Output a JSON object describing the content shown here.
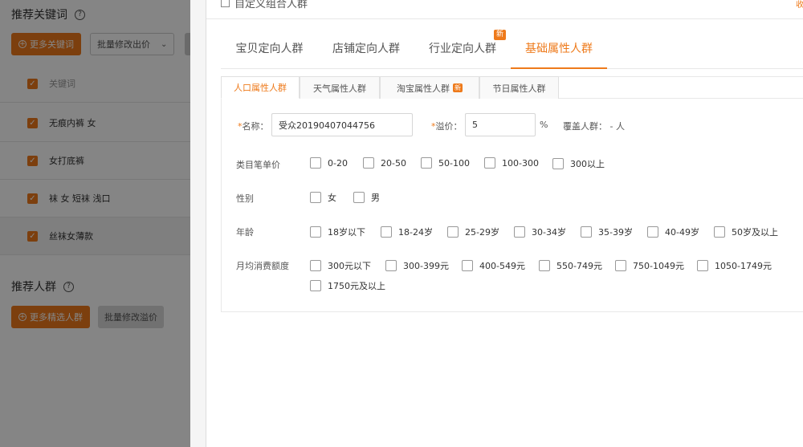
{
  "left_panel": {
    "keywords_title": "推荐关键词",
    "more_keywords_label": "更多关键词",
    "batch_bid_label": "批量修改出价",
    "keyword_header": "关键词",
    "keywords": [
      "无痕内裤 女",
      "女打底裤",
      "袜 女 短袜 浅口",
      "丝袜女薄款"
    ],
    "crowd_title": "推荐人群",
    "more_crowd_label": "更多精选人群",
    "batch_premium_label": "批量修改溢价"
  },
  "modal": {
    "title": "自定义组合人群",
    "collapse_label": "收",
    "main_tabs": [
      {
        "label": "宝贝定向人群"
      },
      {
        "label": "店铺定向人群"
      },
      {
        "label": "行业定向人群",
        "badge": "新"
      },
      {
        "label": "基础属性人群"
      }
    ],
    "active_main_tab": "基础属性人群",
    "sub_tabs": [
      {
        "label": "人口属性人群"
      },
      {
        "label": "天气属性人群"
      },
      {
        "label": "淘宝属性人群",
        "badge": "新"
      },
      {
        "label": "节日属性人群"
      }
    ],
    "active_sub_tab": "人口属性人群",
    "form": {
      "name_label": "名称：",
      "name_value": "受众20190407044756",
      "premium_label": "溢价：",
      "premium_value": "5",
      "premium_unit": "%",
      "coverage_label": "覆盖人群：",
      "coverage_value": "- 人",
      "required_mark": "*"
    },
    "groups": {
      "price": {
        "label": "类目笔单价",
        "options": [
          "0-20",
          "20-50",
          "50-100",
          "100-300",
          "300以上"
        ]
      },
      "gender": {
        "label": "性别",
        "options": [
          "女",
          "男"
        ]
      },
      "age": {
        "label": "年龄",
        "options": [
          "18岁以下",
          "18-24岁",
          "25-29岁",
          "30-34岁",
          "35-39岁",
          "40-49岁",
          "50岁及以上"
        ]
      },
      "spend": {
        "label": "月均消费额度",
        "options": [
          "300元以下",
          "300-399元",
          "400-549元",
          "550-749元",
          "750-1049元",
          "1050-1749元",
          "1750元及以上"
        ]
      }
    }
  },
  "colors": {
    "accent": "#ee7a1b",
    "overlay": "rgba(0,0,0,0.48)"
  }
}
